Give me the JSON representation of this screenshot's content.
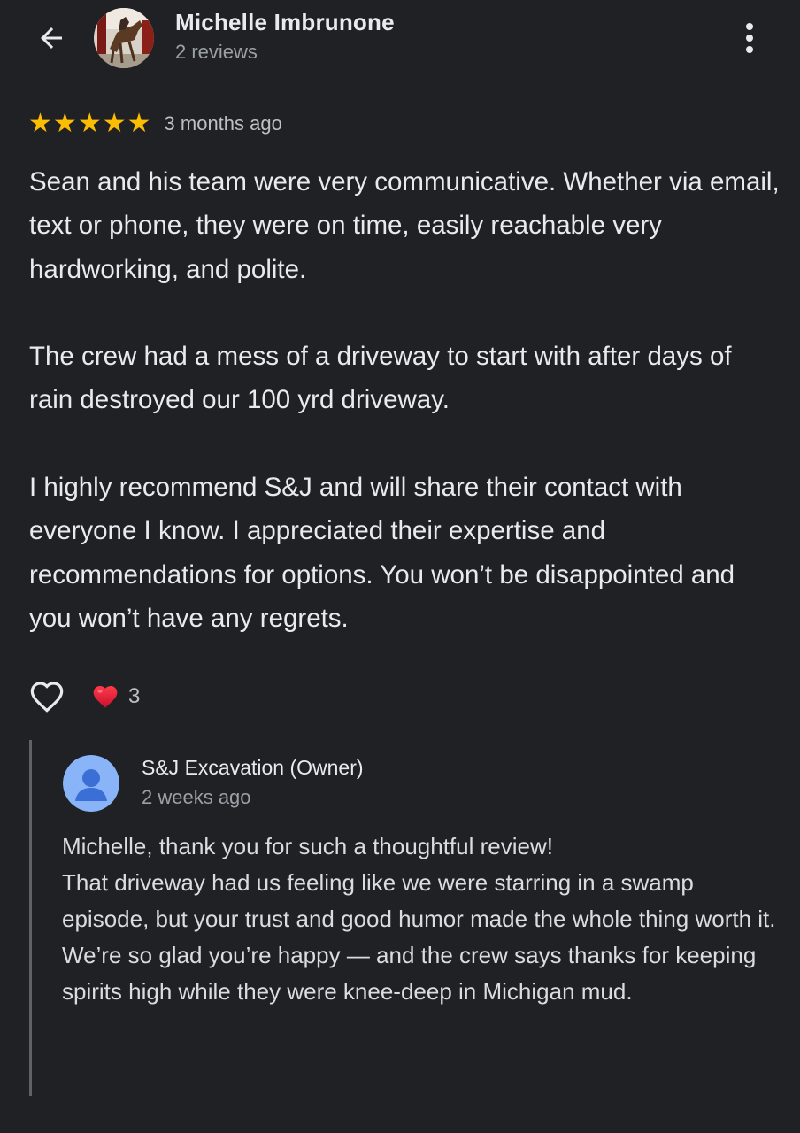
{
  "header": {
    "author_name": "Michelle Imbrunone",
    "author_meta": "2 reviews"
  },
  "review": {
    "rating": 5,
    "rating_max": 5,
    "date": "3 months ago",
    "paragraphs": [
      "Sean and his team were very communicative. Whether via email, text or phone, they were on time, easily reachable very hardworking, and polite.",
      "The crew had a mess of a driveway to start with after days of rain destroyed our 100 yrd driveway.",
      "I highly recommend S&J and will share their contact with everyone I know. I appreciated their expertise and recommendations for options. You won’t be disappointed and you won’t have any regrets."
    ],
    "reaction_emoji": "❤️",
    "reaction_count": "3"
  },
  "reply": {
    "owner_name": "S&J Excavation (Owner)",
    "date": "2 weeks ago",
    "lines": [
      "Michelle, thank you for such a thoughtful review!",
      "That driveway had us feeling like we were starring in a swamp episode, but your trust and good humor made the whole thing worth it.",
      "We’re so glad you’re happy — and the crew says thanks for keeping spirits high while they were knee-deep in Michigan mud."
    ]
  },
  "colors": {
    "background": "#202124",
    "star": "#fbbc04",
    "heart": "#e8112d",
    "owner_avatar": "#8ab4f8"
  },
  "icons": {
    "back": "arrow-left-icon",
    "more": "more-vert-icon",
    "like": "heart-outline-icon",
    "reaction": "red-heart-icon",
    "owner_avatar": "person-icon"
  }
}
